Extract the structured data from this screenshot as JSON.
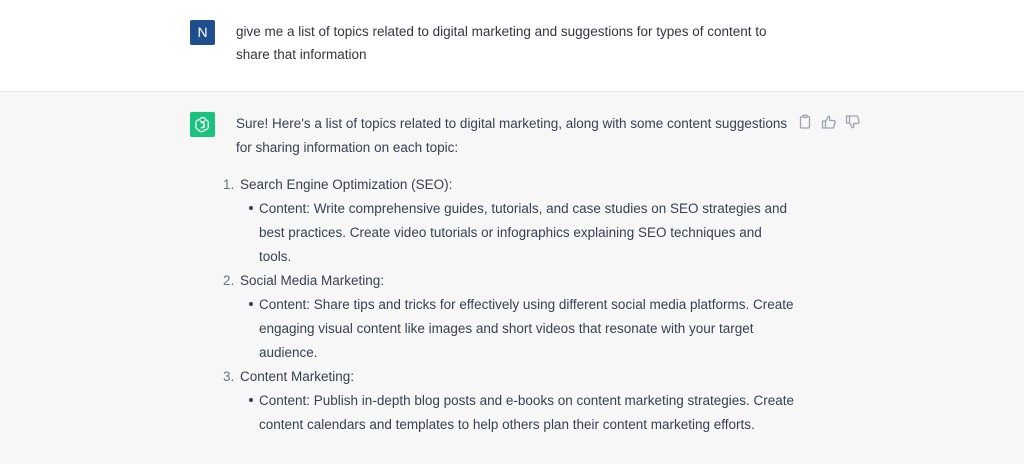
{
  "user": {
    "avatar_initial": "N",
    "avatar_color": "#1f4e8c",
    "message": "give me a list of topics related to digital marketing and suggestions for types of content to share that information"
  },
  "assistant": {
    "avatar_icon": "openai-logo-icon",
    "avatar_color": "#19c37d",
    "intro": "Sure! Here's a list of topics related to digital marketing, along with some content suggestions for sharing information on each topic:",
    "topics": [
      {
        "number": "1.",
        "title": "Search Engine Optimization (SEO):",
        "bullet": "Content: Write comprehensive guides, tutorials, and case studies on SEO strategies and best practices. Create video tutorials or infographics explaining SEO techniques and tools."
      },
      {
        "number": "2.",
        "title": "Social Media Marketing:",
        "bullet": "Content: Share tips and tricks for effectively using different social media platforms. Create engaging visual content like images and short videos that resonate with your target audience."
      },
      {
        "number": "3.",
        "title": "Content Marketing:",
        "bullet": "Content: Publish in-depth blog posts and e-books on content marketing strategies. Create content calendars and templates to help others plan their content marketing efforts."
      }
    ],
    "actions": [
      "copy-icon",
      "thumbs-up-icon",
      "thumbs-down-icon"
    ]
  }
}
